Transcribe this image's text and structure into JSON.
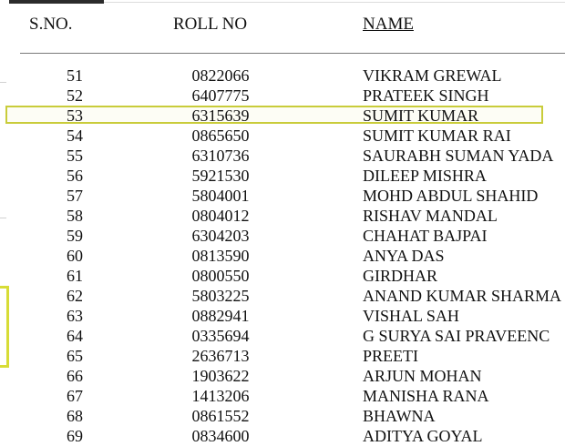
{
  "headers": {
    "sno": "S.NO.",
    "roll": "ROLL NO",
    "name": "NAME"
  },
  "rows": [
    {
      "sno": "51",
      "roll": "0822066",
      "name": "VIKRAM GREWAL"
    },
    {
      "sno": "52",
      "roll": "6407775",
      "name": "PRATEEK SINGH"
    },
    {
      "sno": "53",
      "roll": "6315639",
      "name": "SUMIT KUMAR"
    },
    {
      "sno": "54",
      "roll": "0865650",
      "name": "SUMIT KUMAR RAI"
    },
    {
      "sno": "55",
      "roll": "6310736",
      "name": "SAURABH SUMAN YADA"
    },
    {
      "sno": "56",
      "roll": "5921530",
      "name": "DILEEP MISHRA"
    },
    {
      "sno": "57",
      "roll": "5804001",
      "name": "MOHD ABDUL SHAHID"
    },
    {
      "sno": "58",
      "roll": "0804012",
      "name": "RISHAV MANDAL"
    },
    {
      "sno": "59",
      "roll": "6304203",
      "name": "CHAHAT BAJPAI"
    },
    {
      "sno": "60",
      "roll": "0813590",
      "name": "ANYA DAS"
    },
    {
      "sno": "61",
      "roll": "0800550",
      "name": "GIRDHAR"
    },
    {
      "sno": "62",
      "roll": "5803225",
      "name": "ANAND KUMAR SHARMA"
    },
    {
      "sno": "63",
      "roll": "0882941",
      "name": "VISHAL SAH"
    },
    {
      "sno": "64",
      "roll": "0335694",
      "name": "G SURYA SAI PRAVEENC"
    },
    {
      "sno": "65",
      "roll": "2636713",
      "name": "PREETI"
    },
    {
      "sno": "66",
      "roll": "1903622",
      "name": "ARJUN MOHAN"
    },
    {
      "sno": "67",
      "roll": "1413206",
      "name": "MANISHA RANA"
    },
    {
      "sno": "68",
      "roll": "0861552",
      "name": "BHAWNA"
    },
    {
      "sno": "69",
      "roll": "0834600",
      "name": "ADITYA GOYAL"
    }
  ],
  "highlight": {
    "sno": "53",
    "color": "#c9cc3a"
  }
}
